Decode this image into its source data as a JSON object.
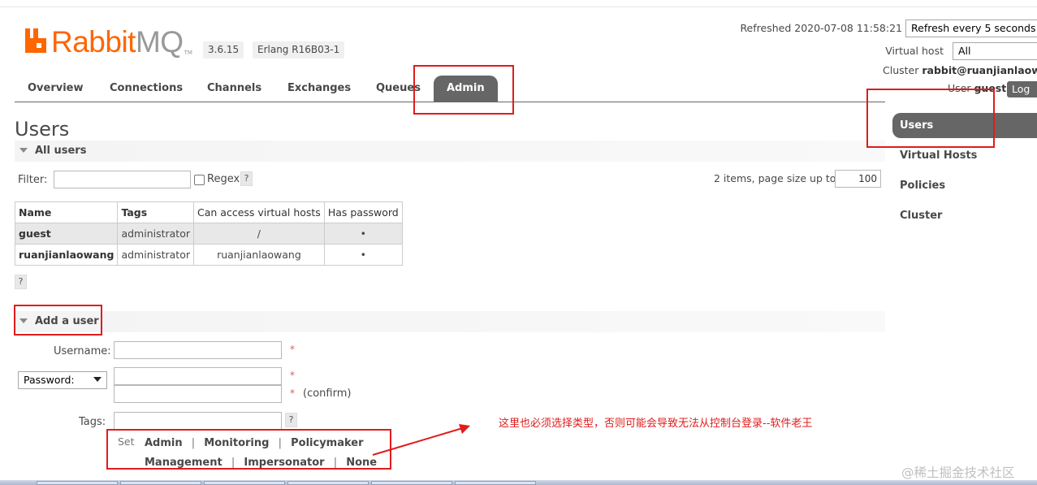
{
  "header": {
    "brand_main": "Rabbit",
    "brand_accent": "MQ",
    "brand_tm": "TM",
    "version": "3.6.15",
    "erlang": "Erlang R16B03-1",
    "refreshed": "Refreshed 2020-07-08 11:58:21",
    "refresh_option": "Refresh every 5 seconds",
    "vhost_label": "Virtual host",
    "vhost_value": "All",
    "cluster_label": "Cluster",
    "cluster_value": "rabbit@ruanjianlaowang",
    "user_label": "User",
    "user_value": "guest",
    "logout_label": "Log out"
  },
  "tabs": [
    "Overview",
    "Connections",
    "Channels",
    "Exchanges",
    "Queues",
    "Admin"
  ],
  "side_nav": [
    "Users",
    "Virtual Hosts",
    "Policies",
    "Cluster"
  ],
  "page": {
    "title": "Users"
  },
  "all_users": {
    "heading": "All users",
    "filter_label": "Filter:",
    "regex_label": "Regex",
    "help": "?",
    "paging_label": "2 items, page size up to",
    "page_size": "100",
    "columns": [
      "Name",
      "Tags",
      "Can access virtual hosts",
      "Has password"
    ],
    "rows": [
      {
        "name": "guest",
        "tags": "administrator",
        "vhosts": "/",
        "has_password": "•"
      },
      {
        "name": "ruanjianlaowang",
        "tags": "administrator",
        "vhosts": "ruanjianlaowang",
        "has_password": "•"
      }
    ]
  },
  "add_user": {
    "heading": "Add a user",
    "username_label": "Username:",
    "password_option": "Password:",
    "required_mark": "*",
    "confirm_label": "(confirm)",
    "tags_label": "Tags:",
    "help": "?",
    "set_label": "Set",
    "tag_options": [
      "Admin",
      "Monitoring",
      "Policymaker",
      "Management",
      "Impersonator",
      "None"
    ],
    "separator": "|"
  },
  "annotation": {
    "note": "这里也必须选择类型，否则可能会导致无法从控制台登录--软件老王",
    "color": "#e01c1c"
  },
  "watermark": "@稀土掘金技术社区",
  "colors": {
    "brand_orange": "#ff6600",
    "tab_active": "#666666",
    "annotation_red": "#e01c1c"
  }
}
